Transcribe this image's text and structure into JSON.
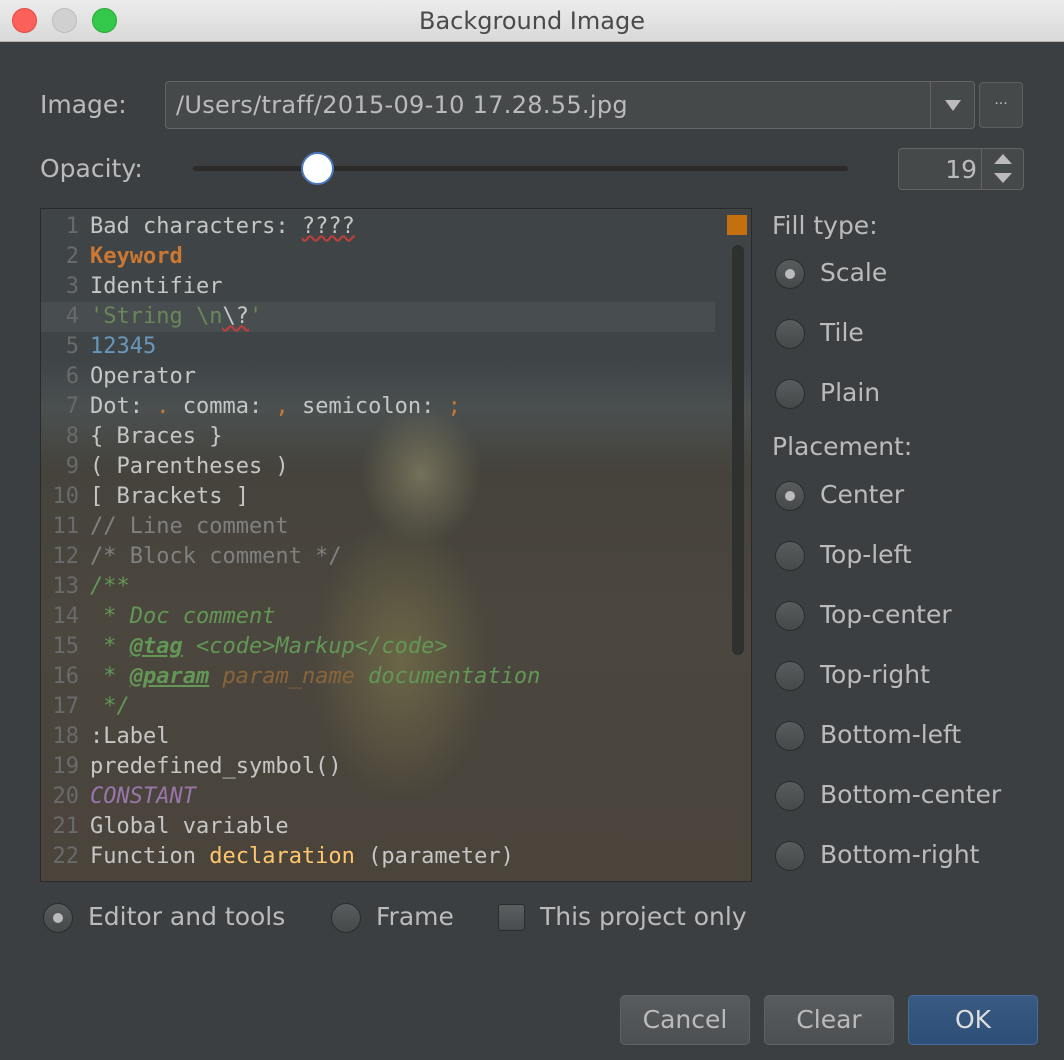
{
  "window": {
    "title": "Background Image"
  },
  "image": {
    "label": "Image:",
    "path": "/Users/traff/2015-09-10 17.28.55.jpg",
    "browse_label": "..."
  },
  "opacity": {
    "label": "Opacity:",
    "value": "19",
    "level_percent": 19
  },
  "editor": {
    "lines": [
      {
        "n": "1",
        "segs": [
          [
            "t-plain",
            "Bad characters: "
          ],
          [
            "t-bad",
            "????"
          ]
        ]
      },
      {
        "n": "2",
        "segs": [
          [
            "t-kw",
            "Keyword"
          ]
        ]
      },
      {
        "n": "3",
        "segs": [
          [
            "t-plain",
            "Identifier"
          ]
        ]
      },
      {
        "n": "4",
        "caret": true,
        "segs": [
          [
            "t-str",
            "'String "
          ],
          [
            "t-str",
            "\\n"
          ],
          [
            "t-bad",
            "\\?"
          ],
          [
            "t-str",
            "'"
          ]
        ]
      },
      {
        "n": "5",
        "segs": [
          [
            "t-num",
            "12345"
          ]
        ]
      },
      {
        "n": "6",
        "segs": [
          [
            "t-plain",
            "Operator"
          ]
        ]
      },
      {
        "n": "7",
        "segs": [
          [
            "t-plain",
            "Dot: "
          ],
          [
            "t-op",
            "."
          ],
          [
            "t-plain",
            " comma: "
          ],
          [
            "t-op",
            ","
          ],
          [
            "t-plain",
            " semicolon: "
          ],
          [
            "t-op",
            ";"
          ]
        ]
      },
      {
        "n": "8",
        "segs": [
          [
            "t-plain",
            "{ Braces }"
          ]
        ]
      },
      {
        "n": "9",
        "segs": [
          [
            "t-plain",
            "( Parentheses )"
          ]
        ]
      },
      {
        "n": "10",
        "segs": [
          [
            "t-plain",
            "[ Brackets ]"
          ]
        ]
      },
      {
        "n": "11",
        "segs": [
          [
            "t-cmt",
            "// Line comment"
          ]
        ]
      },
      {
        "n": "12",
        "segs": [
          [
            "t-cmt",
            "/* Block comment */"
          ]
        ]
      },
      {
        "n": "13",
        "segs": [
          [
            "t-doc",
            "/**"
          ]
        ]
      },
      {
        "n": "14",
        "segs": [
          [
            "t-doc",
            " * Doc comment"
          ]
        ]
      },
      {
        "n": "15",
        "segs": [
          [
            "t-doc",
            " * "
          ],
          [
            "t-tag",
            "@tag"
          ],
          [
            "t-doc",
            " <code>Markup</code>"
          ]
        ]
      },
      {
        "n": "16",
        "segs": [
          [
            "t-doc",
            " * "
          ],
          [
            "t-tag",
            "@param"
          ],
          [
            "t-pname",
            " param_name"
          ],
          [
            "t-doc",
            " documentation"
          ]
        ]
      },
      {
        "n": "17",
        "segs": [
          [
            "t-doc",
            " */"
          ]
        ]
      },
      {
        "n": "18",
        "segs": [
          [
            "t-plain",
            ":Label"
          ]
        ]
      },
      {
        "n": "19",
        "segs": [
          [
            "t-plain",
            "predefined_symbol()"
          ]
        ]
      },
      {
        "n": "20",
        "segs": [
          [
            "t-const",
            "CONSTANT"
          ]
        ]
      },
      {
        "n": "21",
        "segs": [
          [
            "t-plain",
            "Global variable"
          ]
        ]
      },
      {
        "n": "22",
        "segs": [
          [
            "t-plain",
            "Function "
          ],
          [
            "t-decl",
            "declaration"
          ],
          [
            "t-plain",
            " (parameter)"
          ]
        ]
      }
    ]
  },
  "fill_type": {
    "label": "Fill type:",
    "options": [
      {
        "label": "Scale",
        "selected": true
      },
      {
        "label": "Tile",
        "selected": false
      },
      {
        "label": "Plain",
        "selected": false
      }
    ]
  },
  "placement": {
    "label": "Placement:",
    "options": [
      {
        "label": "Center",
        "selected": true
      },
      {
        "label": "Top-left",
        "selected": false
      },
      {
        "label": "Top-center",
        "selected": false
      },
      {
        "label": "Top-right",
        "selected": false
      },
      {
        "label": "Bottom-left",
        "selected": false
      },
      {
        "label": "Bottom-center",
        "selected": false
      },
      {
        "label": "Bottom-right",
        "selected": false
      }
    ]
  },
  "target": {
    "editor_label": "Editor and tools",
    "frame_label": "Frame",
    "project_only_label": "This project only"
  },
  "buttons": {
    "cancel": "Cancel",
    "clear": "Clear",
    "ok": "OK"
  }
}
